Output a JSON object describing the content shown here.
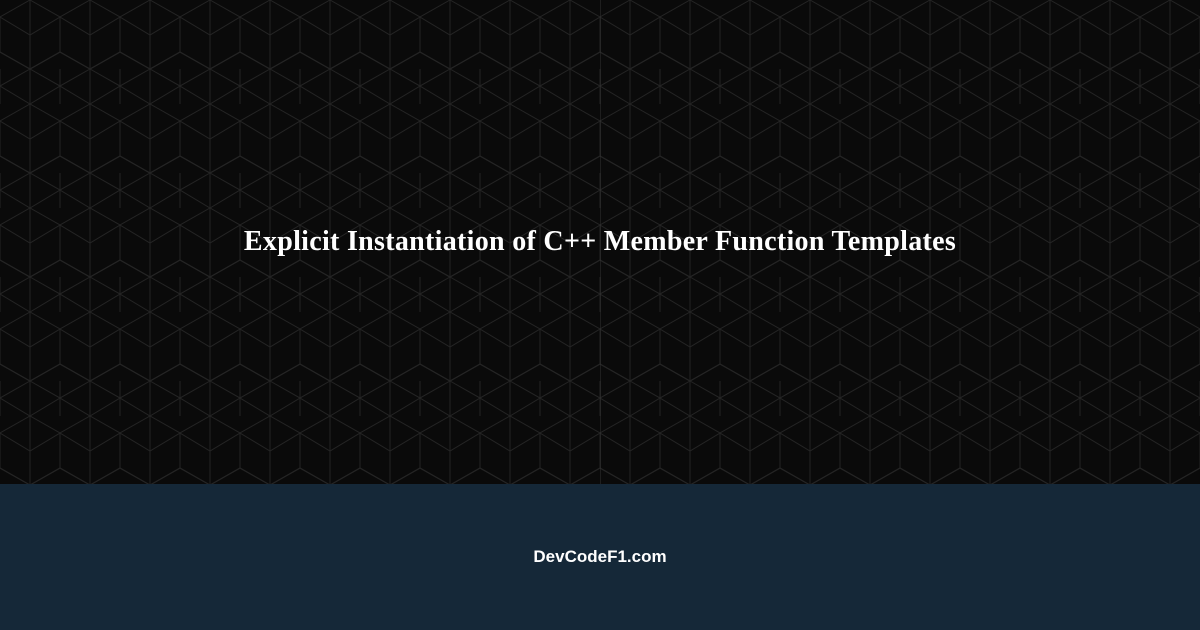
{
  "title": "Explicit Instantiation of C++ Member Function Templates",
  "site_name": "DevCodeF1.com",
  "colors": {
    "top_bg": "#0a0a0a",
    "bottom_bg": "#152838",
    "text": "#ffffff",
    "pattern_stroke": "#3a3a3a"
  }
}
